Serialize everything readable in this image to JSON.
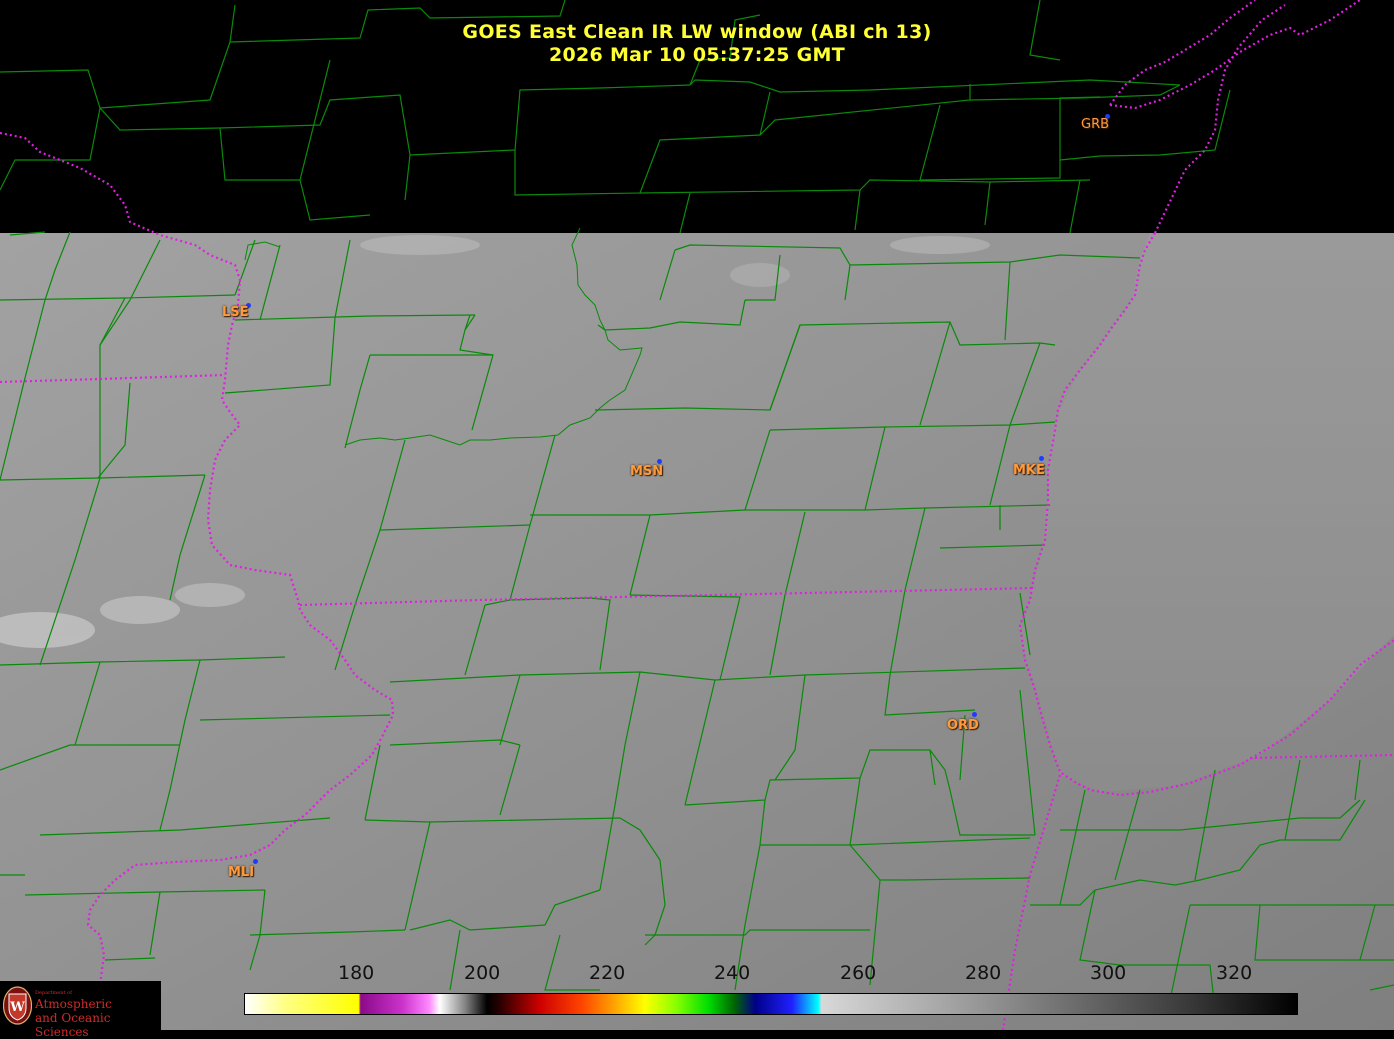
{
  "title": {
    "line1": "GOES East Clean IR LW window (ABI ch 13)",
    "line2": "2026 Mar 10  05:37:25 GMT"
  },
  "stations": [
    {
      "code": "GRB"
    },
    {
      "code": "LSE"
    },
    {
      "code": "MSN"
    },
    {
      "code": "MKE"
    },
    {
      "code": "ORD"
    },
    {
      "code": "MLI"
    }
  ],
  "colorbar": {
    "ticks": [
      "180",
      "200",
      "220",
      "240",
      "260",
      "280",
      "300",
      "320"
    ]
  },
  "colors": {
    "title": "#ffff33",
    "county_lines": "#0a8a0a",
    "state_borders": "#e020e0",
    "station_labels": "#ff9a3c",
    "station_dots": "#1e3cff"
  },
  "logo": {
    "dept": "Department of",
    "line1": "Atmospheric",
    "line2": "and Oceanic Sciences"
  }
}
